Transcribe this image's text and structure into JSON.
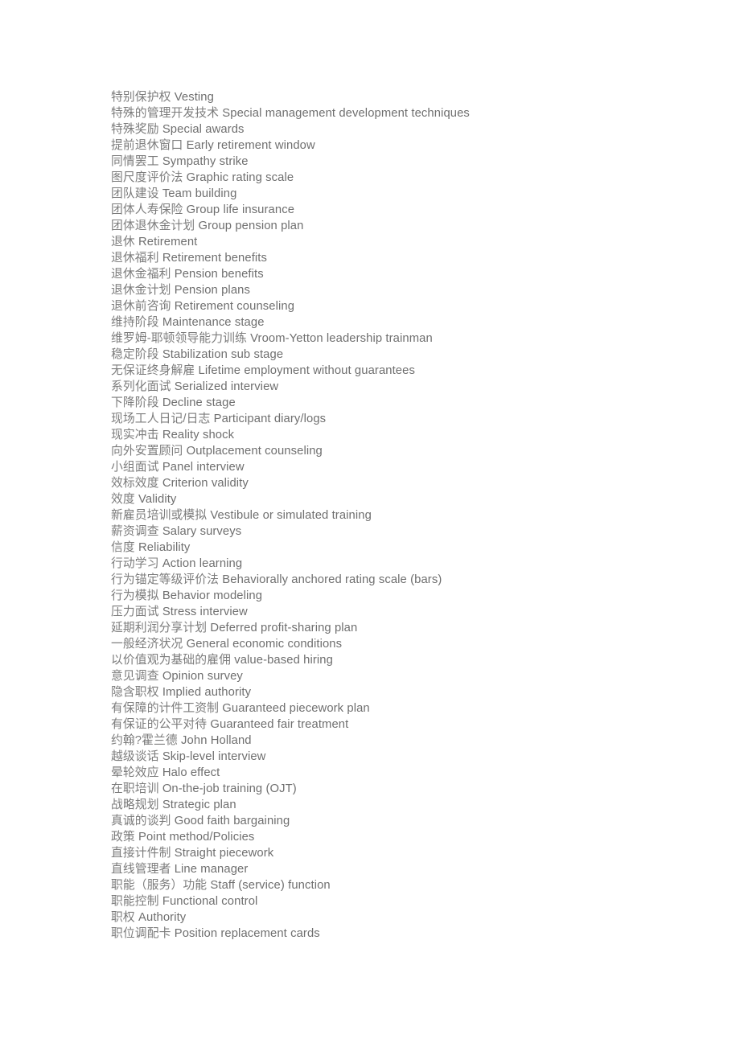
{
  "document": {
    "type": "bilingual-glossary",
    "text_color": "#767676",
    "background_color": "#ffffff",
    "entries": [
      {
        "zh": "特别保护权",
        "en": "Vesting"
      },
      {
        "zh": "特殊的管理开发技术",
        "en": "Special management development techniques"
      },
      {
        "zh": "特殊奖励",
        "en": "Special awards"
      },
      {
        "zh": "提前退休窗口",
        "en": "Early retirement window"
      },
      {
        "zh": "同情罢工",
        "en": "Sympathy strike"
      },
      {
        "zh": "图尺度评价法",
        "en": "Graphic rating scale"
      },
      {
        "zh": "团队建设",
        "en": "Team building"
      },
      {
        "zh": "团体人寿保险",
        "en": "Group life insurance"
      },
      {
        "zh": "团体退休金计划",
        "en": "Group pension plan"
      },
      {
        "zh": "退休",
        "en": "Retirement"
      },
      {
        "zh": "退休福利",
        "en": "Retirement benefits"
      },
      {
        "zh": "退休金福利",
        "en": "Pension benefits"
      },
      {
        "zh": "退休金计划",
        "en": "Pension plans"
      },
      {
        "zh": "退休前咨询",
        "en": "Retirement counseling"
      },
      {
        "zh": "维持阶段",
        "en": "Maintenance stage"
      },
      {
        "zh": "维罗姆-耶顿领导能力训练",
        "en": "Vroom-Yetton leadership trainman"
      },
      {
        "zh": "稳定阶段",
        "en": "Stabilization sub stage"
      },
      {
        "zh": "无保证终身解雇",
        "en": "Lifetime employment without guarantees"
      },
      {
        "zh": "系列化面试",
        "en": "Serialized interview"
      },
      {
        "zh": "下降阶段",
        "en": "Decline stage"
      },
      {
        "zh": "现场工人日记/日志",
        "en": "Participant diary/logs"
      },
      {
        "zh": "现实冲击",
        "en": "Reality shock"
      },
      {
        "zh": "向外安置顾问",
        "en": "Outplacement counseling"
      },
      {
        "zh": "小组面试",
        "en": "Panel interview"
      },
      {
        "zh": "效标效度",
        "en": "Criterion validity"
      },
      {
        "zh": "效度",
        "en": "Validity"
      },
      {
        "zh": "新雇员培训或模拟",
        "en": "Vestibule or simulated training"
      },
      {
        "zh": "薪资调查",
        "en": "Salary surveys"
      },
      {
        "zh": "信度",
        "en": "Reliability"
      },
      {
        "zh": "行动学习",
        "en": "Action learning"
      },
      {
        "zh": "行为锚定等级评价法",
        "en": "Behaviorally anchored rating scale (bars)"
      },
      {
        "zh": "行为模拟",
        "en": "Behavior modeling"
      },
      {
        "zh": "压力面试",
        "en": "Stress interview"
      },
      {
        "zh": "延期利润分享计划",
        "en": "Deferred profit-sharing plan"
      },
      {
        "zh": "一般经济状况",
        "en": "General economic conditions"
      },
      {
        "zh": "以价值观为基础的雇佣",
        "en": "value-based hiring"
      },
      {
        "zh": "意见调查",
        "en": "Opinion survey"
      },
      {
        "zh": "隐含职权",
        "en": "Implied authority"
      },
      {
        "zh": "有保障的计件工资制",
        "en": "Guaranteed piecework plan"
      },
      {
        "zh": "有保证的公平对待",
        "en": "Guaranteed fair treatment"
      },
      {
        "zh": "约翰?霍兰德",
        "en": "John Holland"
      },
      {
        "zh": "越级谈话",
        "en": "Skip-level interview"
      },
      {
        "zh": "晕轮效应",
        "en": "Halo effect"
      },
      {
        "zh": "在职培训",
        "en": "On-the-job training (OJT)"
      },
      {
        "zh": "战略规划",
        "en": "Strategic plan"
      },
      {
        "zh": "真诚的谈判",
        "en": "Good faith bargaining"
      },
      {
        "zh": "政策",
        "en": "Point method/Policies"
      },
      {
        "zh": "直接计件制",
        "en": "Straight piecework"
      },
      {
        "zh": "直线管理者",
        "en": "Line manager"
      },
      {
        "zh": "职能（服务）功能",
        "en": "Staff (service) function"
      },
      {
        "zh": "职能控制",
        "en": "Functional control"
      },
      {
        "zh": "职权",
        "en": "Authority"
      },
      {
        "zh": "职位调配卡",
        "en": "Position replacement cards"
      }
    ]
  }
}
